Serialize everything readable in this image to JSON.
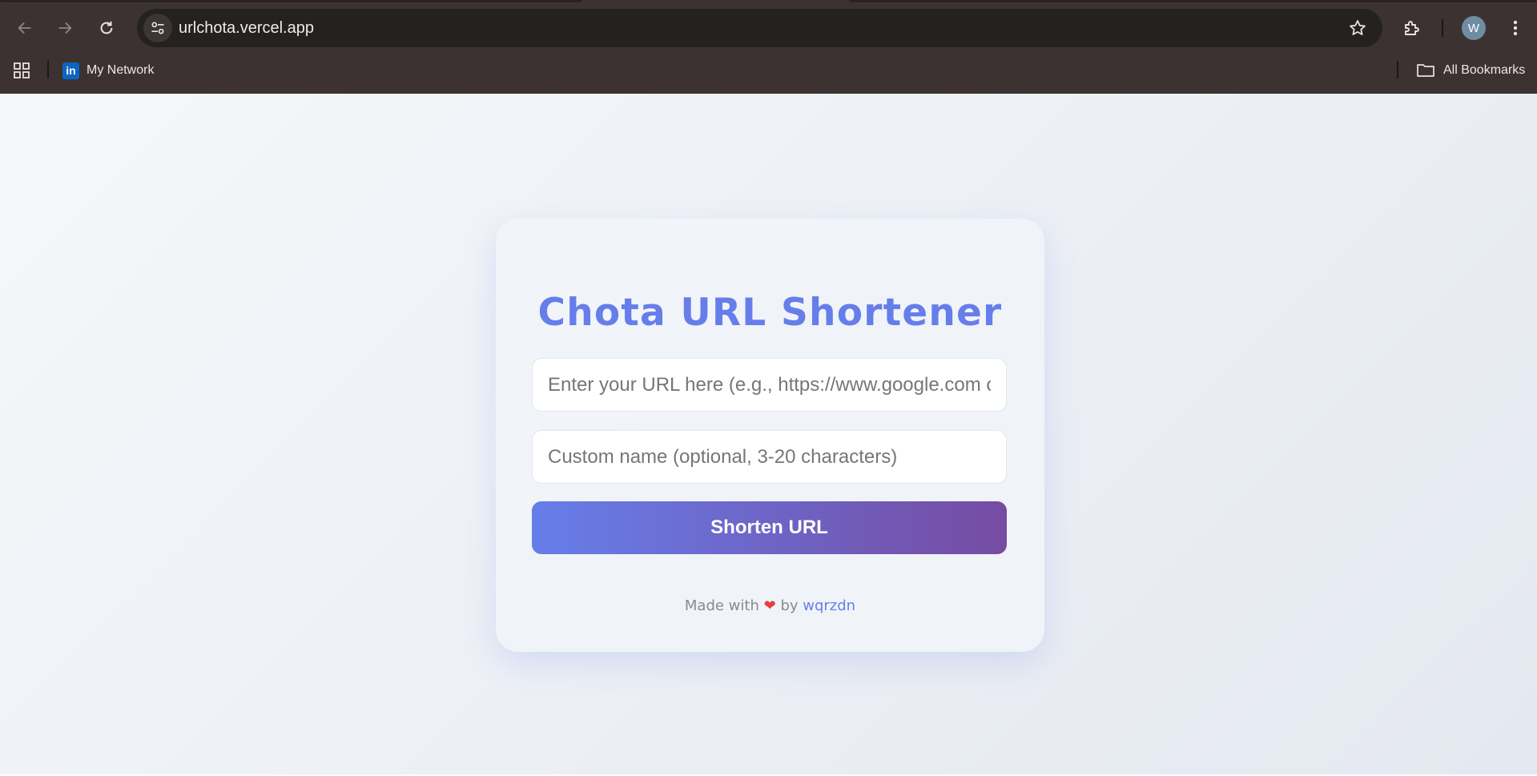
{
  "browser": {
    "url": "urlchota.vercel.app",
    "profile_initial": "W",
    "bookmarks": [
      {
        "label": "My Network",
        "icon": "linkedin-icon",
        "icon_text": "in"
      }
    ],
    "all_bookmarks_label": "All Bookmarks"
  },
  "app": {
    "title": "Chota URL Shortener",
    "url_placeholder": "Enter your URL here (e.g., https://www.google.com or google.com)",
    "custom_placeholder": "Custom name (optional, 3-20 characters)",
    "submit_label": "Shorten URL",
    "footer": {
      "made_with": "Made with",
      "heart": "❤",
      "by": "by",
      "author": "wqrzdn"
    }
  },
  "colors": {
    "accent": "#667eea",
    "gradient_end": "#764ba2",
    "heart": "#e53e3e",
    "chrome": "#3c3231"
  }
}
